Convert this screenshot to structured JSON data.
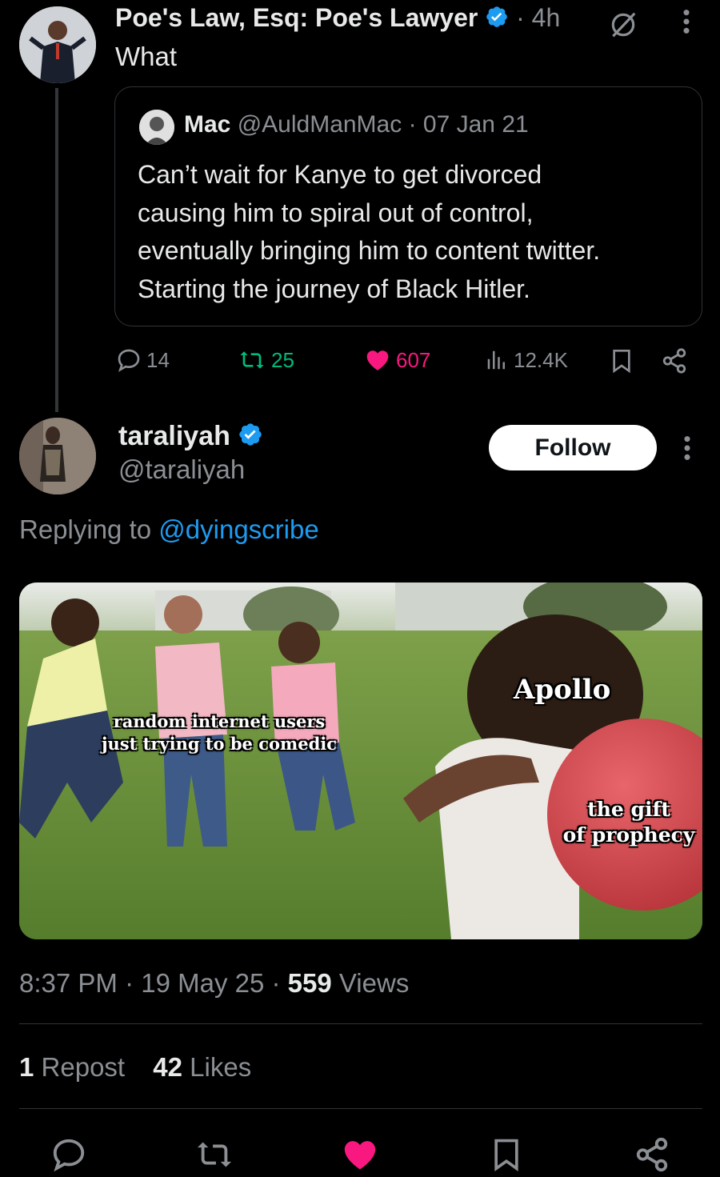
{
  "parent_tweet": {
    "display_name": "Poe's Law, Esq: Poe's Lawyer",
    "time": "· 4h",
    "text": "What",
    "quoted": {
      "name": "Mac",
      "handle": "@AuldManMac",
      "date": "· 07 Jan 21",
      "lines": [
        "Can’t wait for Kanye to get divorced",
        "causing him to spiral out of control,",
        "eventually bringing him to content twitter.",
        "Starting the journey of Black Hitler."
      ]
    },
    "stats": {
      "replies": "14",
      "reposts": "25",
      "likes": "607",
      "views": "12.4K"
    }
  },
  "main_tweet": {
    "display_name": "taraliyah",
    "handle": "@taraliyah",
    "follow_label": "Follow",
    "replying_prefix": "Replying to",
    "replying_to": "@dyingscribe",
    "meme": {
      "caption_left_1": "random internet users",
      "caption_left_2": "just trying to be comedic",
      "caption_right_top": "Apollo",
      "caption_ball_1": "the gift",
      "caption_ball_2": "of prophecy"
    },
    "timestamp": "8:37 PM · 19 May 25 ·",
    "views_count": "559",
    "views_label": "Views",
    "repost_count": "1",
    "repost_label": "Repost",
    "likes_count": "42",
    "likes_label": "Likes"
  },
  "icons": {
    "verified": "verified-badge-icon",
    "reply": "reply-icon",
    "repost": "repost-icon",
    "like": "heart-icon",
    "views": "views-icon",
    "bookmark": "bookmark-icon",
    "share": "share-icon",
    "more": "more-icon",
    "grok": "grok-icon"
  },
  "colors": {
    "accent_blue": "#1d9bf0",
    "repost_green": "#00ba7c",
    "like_pink": "#f91880",
    "background": "#000000"
  }
}
